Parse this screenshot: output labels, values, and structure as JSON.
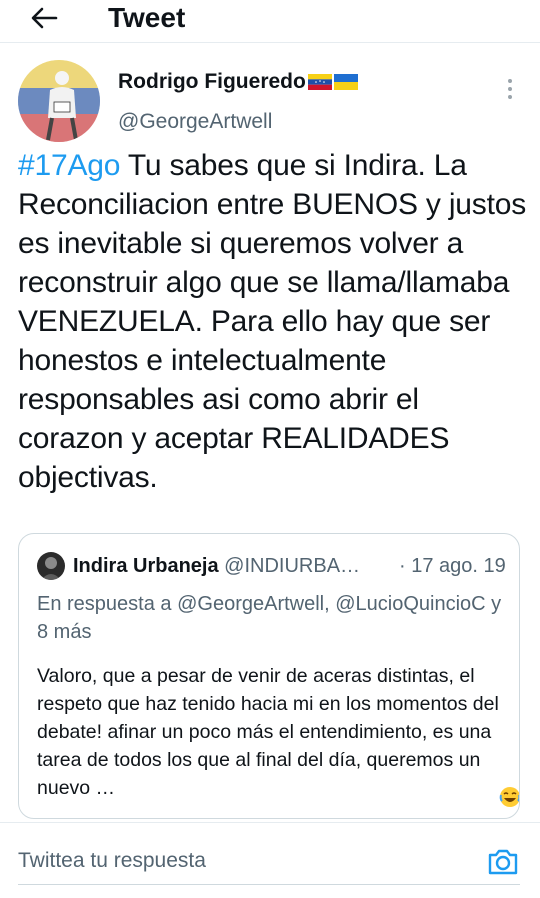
{
  "header": {
    "title": "Tweet",
    "back_icon": "arrow-left-icon"
  },
  "tweet": {
    "author_name": "Rodrigo Figueredo",
    "author_flags": [
      "venezuela-flag-icon",
      "ukraine-flag-icon"
    ],
    "author_handle": "@GeorgeArtwell",
    "hashtag": "#17Ago",
    "text": " Tu sabes que si Indira. La Reconciliacion entre BUENOS y justos es inevitable si queremos volver a reconstruir algo que se llama/llamaba VENEZUELA. Para ello hay que ser honestos e intelectualmente responsables asi como abrir el corazon y aceptar REALIDADES objectivas."
  },
  "quote": {
    "author_name": "Indira Urbaneja",
    "author_handle": "@INDIURBA…",
    "date": "· 17 ago. 19",
    "reply_prefix": "En respuesta a ",
    "reply_targets": "@GeorgeArtwell, @LucioQuincioC y 8 más",
    "text": "Valoro, que a pesar de venir de aceras distintas, el respeto que haz tenido hacia mi en los momentos del debate! afinar un poco más el entendimiento, es una tarea de todos los que al final del día, queremos un nuevo …",
    "emoji": "laughing-emoji"
  },
  "reply_bar": {
    "placeholder": "Twittea tu respuesta",
    "camera_icon": "camera-icon"
  },
  "colors": {
    "accent": "#1d9bf0",
    "secondary_text": "#536471",
    "primary_text": "#0f1419"
  }
}
